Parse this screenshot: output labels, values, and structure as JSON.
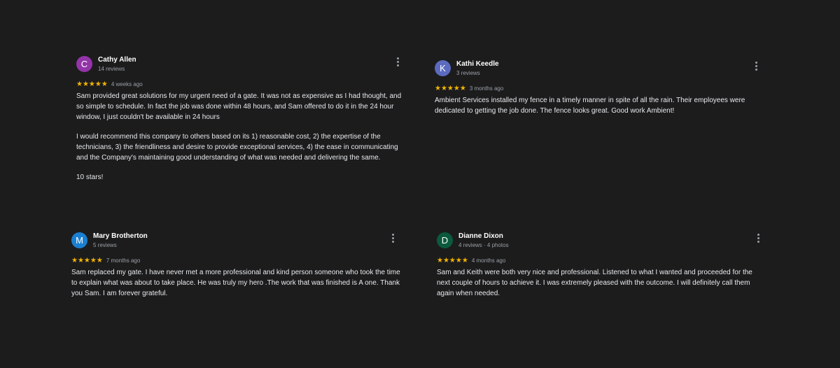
{
  "reviews": [
    {
      "avatar_letter": "C",
      "avatar_color": "#9334a8",
      "name": "Cathy Allen",
      "meta": "14 reviews",
      "stars": "★★★★★",
      "date": "4 weeks ago",
      "paragraphs": [
        "Sam provided great solutions for my urgent need of a gate. It was not as expensive as I had thought, and so simple to schedule. In fact the job was done within 48 hours, and Sam offered to do it in the 24 hour window, I just couldn't be available in 24 hours",
        "I would recommend this company to others based on its 1) reasonable cost, 2) the expertise of the technicians, 3) the friendliness and desire to provide exceptional services, 4) the ease in communicating and the Company's maintaining good understanding of what was needed and delivering the same.",
        "10 stars!"
      ]
    },
    {
      "avatar_letter": "K",
      "avatar_color": "#5c6bc0",
      "name": "Kathi Keedle",
      "meta": "3 reviews",
      "stars": "★★★★★",
      "date": "3 months ago",
      "paragraphs": [
        "Ambient Services installed my fence in a timely manner in spite of all the rain. Their employees were dedicated to getting the job done. The fence looks great. Good work Ambient!"
      ]
    },
    {
      "avatar_letter": "M",
      "avatar_color": "#1a7fd1",
      "name": "Mary Brotherton",
      "meta": "5 reviews",
      "stars": "★★★★★",
      "date": "7 months ago",
      "paragraphs": [
        "Sam replaced my gate. I have never met a more professional and kind person someone who took the time to explain what was about to take place. He was truly my hero .The work that was finished is A one. Thank you Sam. I am forever grateful."
      ]
    },
    {
      "avatar_letter": "D",
      "avatar_color": "#0b5a3e",
      "name": "Dianne Dixon",
      "meta": "4 reviews · 4 photos",
      "stars": "★★★★★",
      "date": "4 months ago",
      "paragraphs": [
        "Sam and Keith were both very nice and professional. Listened to what I wanted and proceeded for the next couple of hours to achieve it. I was extremely pleased with the outcome. I will definitely call them again when needed."
      ]
    }
  ]
}
